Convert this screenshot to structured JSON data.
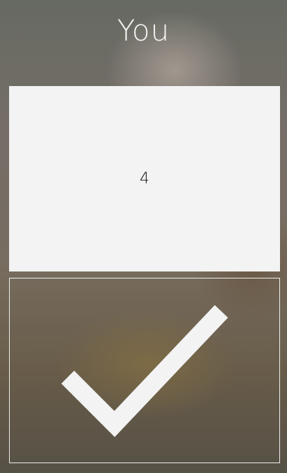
{
  "header": {
    "title": "You"
  },
  "card": {
    "value": "4"
  },
  "confirm": {
    "icon": "check-icon",
    "icon_color": "#f3f3f3"
  },
  "colors": {
    "card_background": "#f3f3f3",
    "title_text": "#f4f4f4",
    "border": "#eeeeee"
  }
}
